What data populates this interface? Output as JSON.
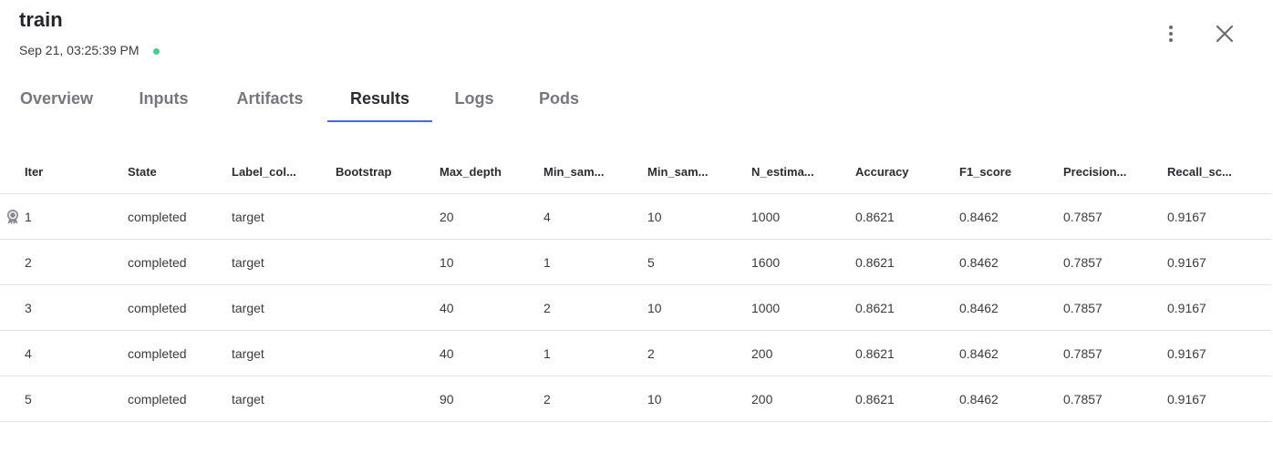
{
  "header": {
    "title": "train",
    "timestamp": "Sep 21, 03:25:39 PM",
    "status_color": "#49cc90"
  },
  "actions": {
    "more_icon": "vertical-dots-icon",
    "close_icon": "close-icon"
  },
  "tabs": [
    {
      "label": "Overview",
      "active": false
    },
    {
      "label": "Inputs",
      "active": false
    },
    {
      "label": "Artifacts",
      "active": false
    },
    {
      "label": "Results",
      "active": true
    },
    {
      "label": "Logs",
      "active": false
    },
    {
      "label": "Pods",
      "active": false
    }
  ],
  "table": {
    "headers": [
      "Iter",
      "State",
      "Label_col...",
      "Bootstrap",
      "Max_depth",
      "Min_sam...",
      "Min_sam...",
      "N_estima...",
      "Accuracy",
      "F1_score",
      "Precision...",
      "Recall_sc..."
    ],
    "rows": [
      {
        "best": true,
        "cells": [
          "1",
          "completed",
          "target",
          "",
          "20",
          "4",
          "10",
          "1000",
          "0.8621",
          "0.8462",
          "0.7857",
          "0.9167"
        ]
      },
      {
        "best": false,
        "cells": [
          "2",
          "completed",
          "target",
          "",
          "10",
          "1",
          "5",
          "1600",
          "0.8621",
          "0.8462",
          "0.7857",
          "0.9167"
        ]
      },
      {
        "best": false,
        "cells": [
          "3",
          "completed",
          "target",
          "",
          "40",
          "2",
          "10",
          "1000",
          "0.8621",
          "0.8462",
          "0.7857",
          "0.9167"
        ]
      },
      {
        "best": false,
        "cells": [
          "4",
          "completed",
          "target",
          "",
          "40",
          "1",
          "2",
          "200",
          "0.8621",
          "0.8462",
          "0.7857",
          "0.9167"
        ]
      },
      {
        "best": false,
        "cells": [
          "5",
          "completed",
          "target",
          "",
          "90",
          "2",
          "10",
          "200",
          "0.8621",
          "0.8462",
          "0.7857",
          "0.9167"
        ]
      }
    ],
    "best_icon": "award-medal-icon"
  },
  "colors": {
    "accent": "#4a6bd1",
    "status_dot": "#49cc90"
  }
}
